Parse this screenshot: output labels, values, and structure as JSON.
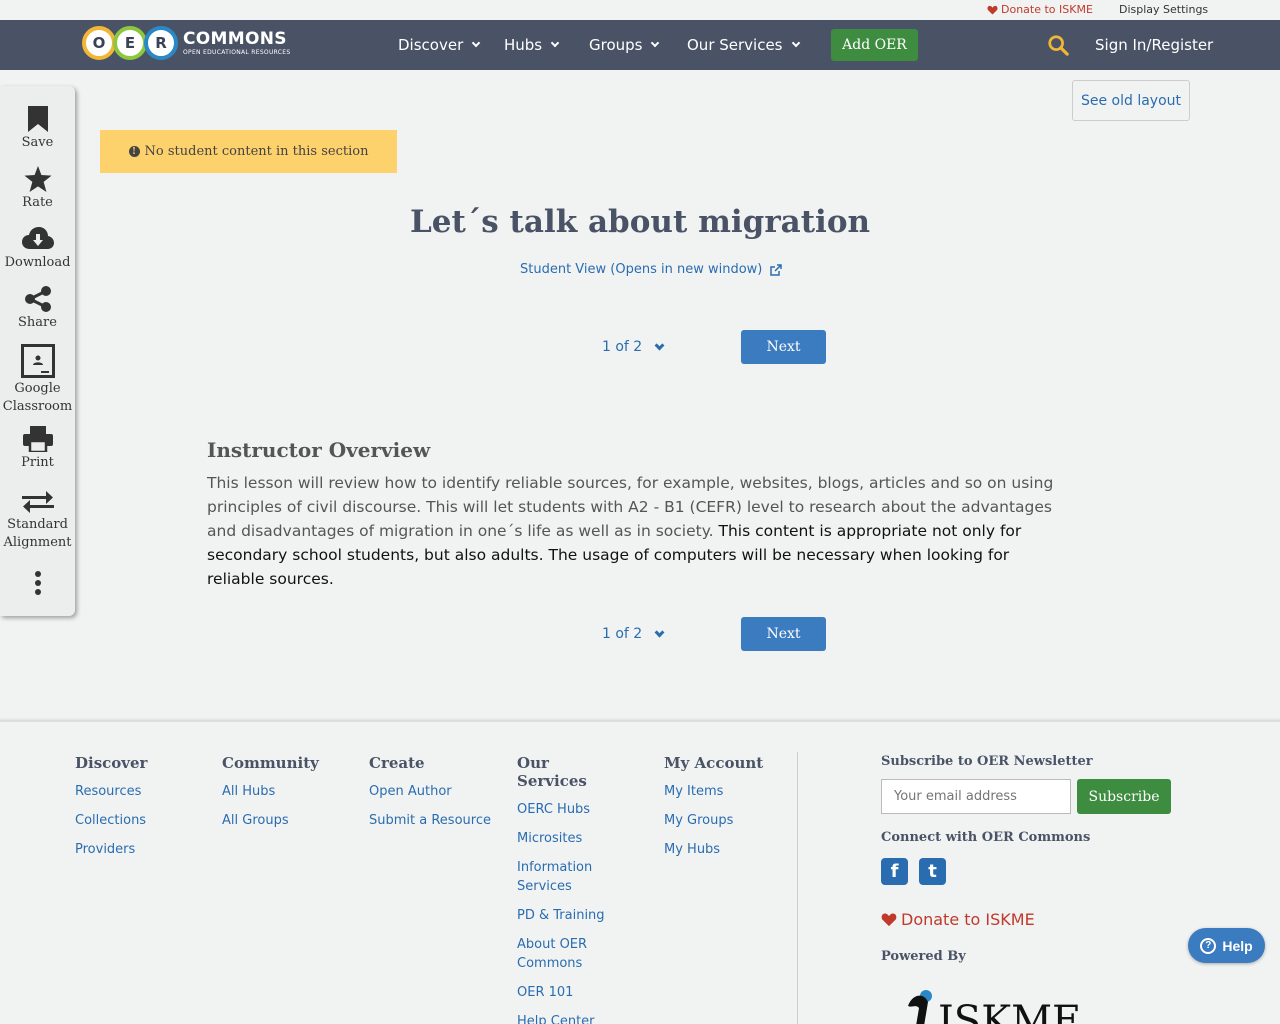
{
  "utility_bar": {
    "donate_label": "Donate to ISKME",
    "display_settings_label": "Display Settings"
  },
  "navbar": {
    "logo_letters": [
      "O",
      "E",
      "R"
    ],
    "logo_text": "COMMONS",
    "logo_subtext": "OPEN EDUCATIONAL RESOURCES",
    "menu": [
      {
        "label": "Discover"
      },
      {
        "label": "Hubs"
      },
      {
        "label": "Groups"
      },
      {
        "label": "Our Services"
      }
    ],
    "add_oer_label": "Add OER",
    "search_icon": "search-icon",
    "signin_label": "Sign In/Register"
  },
  "sidebar": {
    "items": [
      {
        "label": "Save",
        "icon": "bookmark-icon"
      },
      {
        "label": "Rate",
        "icon": "star-icon"
      },
      {
        "label": "Download",
        "icon": "cloud-download-icon"
      },
      {
        "label": "Share",
        "icon": "share-icon"
      },
      {
        "label": "Google Classroom",
        "icon": "google-classroom-icon"
      },
      {
        "label": "Print",
        "icon": "print-icon"
      },
      {
        "label": "Standard Alignment",
        "icon": "exchange-icon"
      },
      {
        "label": "",
        "icon": "more-vertical-icon"
      }
    ]
  },
  "main": {
    "old_layout_label": "See old layout",
    "notice_text": "No student content in this section",
    "title": "Let´s talk about migration",
    "student_view_label": "Student View (Opens in new window)",
    "pager": {
      "page_text": "1 of 2",
      "next_label": "Next"
    },
    "overview": {
      "heading": "Instructor Overview",
      "body_part1": "This lesson will review how to identify reliable sources, for example, websites, blogs, articles and so on using principles of civil discourse. This will let students with A2 - B1 (CEFR) level to research about the advantages and disadvantages of migration in one´s life as well as in society. ",
      "body_part2": "This content is appropriate not only for secondary school students, but also adults. The usage of computers will be necessary when looking for reliable sources."
    }
  },
  "footer": {
    "columns": [
      {
        "heading": "Discover",
        "links": [
          "Resources",
          "Collections",
          "Providers"
        ]
      },
      {
        "heading": "Community",
        "links": [
          "All Hubs",
          "All Groups"
        ]
      },
      {
        "heading": "Create",
        "links": [
          "Open Author",
          "Submit a Resource"
        ]
      },
      {
        "heading": "Our Services",
        "links": [
          "OERC Hubs",
          "Microsites",
          "Information Services",
          "PD & Training",
          "About OER Commons",
          "OER 101",
          "Help Center"
        ]
      },
      {
        "heading": "My Account",
        "links": [
          "My Items",
          "My Groups",
          "My Hubs"
        ]
      }
    ],
    "newsletter_title": "Subscribe to OER Newsletter",
    "email_placeholder": "Your email address",
    "subscribe_label": "Subscribe",
    "connect_title": "Connect with OER Commons",
    "social": [
      {
        "name": "facebook",
        "icon": "facebook-icon",
        "glyph": "f"
      },
      {
        "name": "twitter",
        "icon": "twitter-icon",
        "glyph": "t"
      }
    ],
    "donate_label": "Donate to ISKME",
    "powered_by_label": "Powered By",
    "iskme_logo_text": "ISKME"
  },
  "help_button_label": "Help",
  "colors": {
    "navbar": "#4a5366",
    "accent_green": "#3d8c40",
    "link_blue": "#2a6cb0",
    "button_blue": "#3b7bbf",
    "notice_yellow": "#fdd16c",
    "donate_red": "#c0392b"
  }
}
